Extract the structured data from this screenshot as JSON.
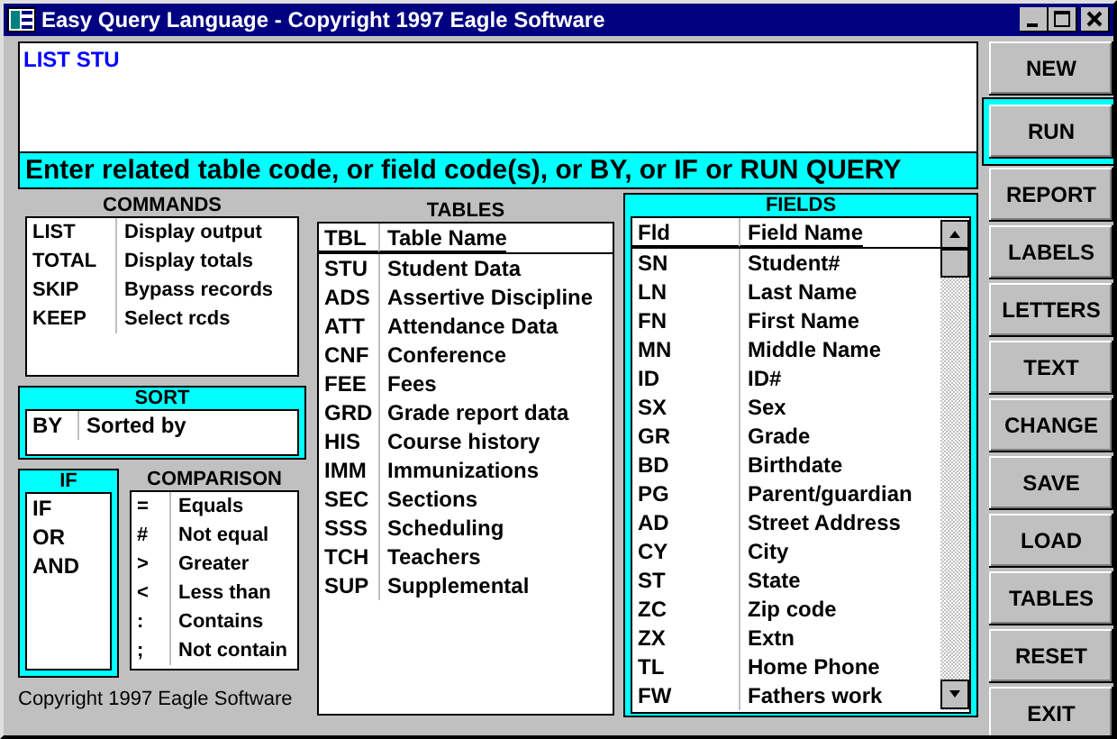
{
  "window": {
    "title": "Easy Query Language - Copyright 1997 Eagle Software"
  },
  "query": {
    "value": "LIST STU"
  },
  "prompt": "Enter related table code, or field code(s), or BY, or IF or RUN QUERY",
  "buttons": [
    {
      "label": "NEW",
      "focused": false
    },
    {
      "label": "RUN",
      "focused": true
    },
    {
      "label": "REPORT",
      "focused": false
    },
    {
      "label": "LABELS",
      "focused": false
    },
    {
      "label": "LETTERS",
      "focused": false
    },
    {
      "label": "TEXT",
      "focused": false
    },
    {
      "label": "CHANGE",
      "focused": false
    },
    {
      "label": "SAVE",
      "focused": false
    },
    {
      "label": "LOAD",
      "focused": false
    },
    {
      "label": "TABLES",
      "focused": false
    },
    {
      "label": "RESET",
      "focused": false
    },
    {
      "label": "EXIT",
      "focused": false
    }
  ],
  "commands": {
    "title": "COMMANDS",
    "items": [
      {
        "code": "LIST",
        "desc": "Display output"
      },
      {
        "code": "TOTAL",
        "desc": "Display totals"
      },
      {
        "code": "SKIP",
        "desc": "Bypass records"
      },
      {
        "code": "KEEP",
        "desc": "Select rcds"
      }
    ]
  },
  "sort": {
    "title": "SORT",
    "items": [
      {
        "code": "BY",
        "desc": "Sorted by"
      }
    ]
  },
  "if": {
    "title": "IF",
    "items": [
      "IF",
      "OR",
      "AND"
    ]
  },
  "comparison": {
    "title": "COMPARISON",
    "items": [
      {
        "code": "=",
        "desc": "Equals"
      },
      {
        "code": "#",
        "desc": "Not equal"
      },
      {
        "code": ">",
        "desc": "Greater"
      },
      {
        "code": "<",
        "desc": "Less than"
      },
      {
        "code": ":",
        "desc": "Contains"
      },
      {
        "code": ";",
        "desc": "Not contain"
      }
    ]
  },
  "copyright": "Copyright 1997 Eagle Software",
  "tables": {
    "title": "TABLES",
    "columns": [
      "TBL",
      "Table Name"
    ],
    "rows": [
      {
        "code": "STU",
        "desc": "Student Data"
      },
      {
        "code": "ADS",
        "desc": "Assertive Discipline"
      },
      {
        "code": "ATT",
        "desc": "Attendance Data"
      },
      {
        "code": "CNF",
        "desc": "Conference"
      },
      {
        "code": "FEE",
        "desc": "Fees"
      },
      {
        "code": "GRD",
        "desc": "Grade report data"
      },
      {
        "code": "HIS",
        "desc": "Course history"
      },
      {
        "code": "IMM",
        "desc": "Immunizations"
      },
      {
        "code": "SEC",
        "desc": "Sections"
      },
      {
        "code": "SSS",
        "desc": "Scheduling"
      },
      {
        "code": "TCH",
        "desc": "Teachers"
      },
      {
        "code": "SUP",
        "desc": "Supplemental"
      }
    ]
  },
  "fields": {
    "title": "FIELDS",
    "columns": [
      "Fld",
      "Field Name"
    ],
    "rows": [
      {
        "code": "SN",
        "desc": "Student#"
      },
      {
        "code": "LN",
        "desc": "Last Name"
      },
      {
        "code": "FN",
        "desc": "First Name"
      },
      {
        "code": "MN",
        "desc": "Middle Name"
      },
      {
        "code": "ID",
        "desc": "ID#"
      },
      {
        "code": "SX",
        "desc": "Sex"
      },
      {
        "code": "GR",
        "desc": "Grade"
      },
      {
        "code": "BD",
        "desc": "Birthdate"
      },
      {
        "code": "PG",
        "desc": "Parent/guardian"
      },
      {
        "code": "AD",
        "desc": "Street Address"
      },
      {
        "code": "CY",
        "desc": "City"
      },
      {
        "code": "ST",
        "desc": "State"
      },
      {
        "code": "ZC",
        "desc": "Zip code"
      },
      {
        "code": "ZX",
        "desc": "Extn"
      },
      {
        "code": "TL",
        "desc": "Home Phone"
      },
      {
        "code": "FW",
        "desc": "Fathers work"
      }
    ]
  }
}
